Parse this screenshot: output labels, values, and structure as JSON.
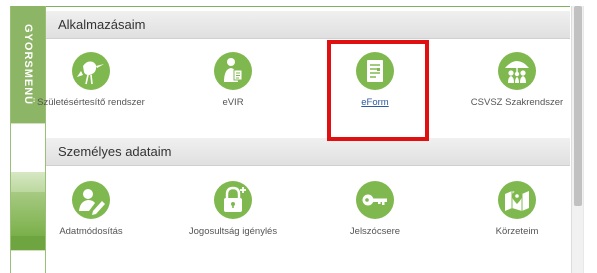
{
  "sidebar": {
    "label": "GYORSMENÜ"
  },
  "sections": {
    "apps_title": "Alkalmazásaim",
    "personal_title": "Személyes adataim"
  },
  "apps": [
    {
      "label": "Születésértesítő rendszer",
      "icon": "stork-icon"
    },
    {
      "label": "eVIR",
      "icon": "person-document-icon"
    },
    {
      "label": "eForm",
      "icon": "form-document-icon"
    },
    {
      "label": "CSVSZ Szakrendszer",
      "icon": "family-umbrella-icon"
    }
  ],
  "personal": [
    {
      "label": "Adatmódosítás",
      "icon": "user-edit-icon"
    },
    {
      "label": "Jogosultság igénylés",
      "icon": "lock-add-icon"
    },
    {
      "label": "Jelszócsere",
      "icon": "key-icon"
    },
    {
      "label": "Körzeteim",
      "icon": "map-pin-icon"
    }
  ],
  "colors": {
    "icon_green": "#80b850",
    "sidebar_green": "#8cb566",
    "highlight_red": "#e01010",
    "link_blue": "#2c5aa0"
  }
}
